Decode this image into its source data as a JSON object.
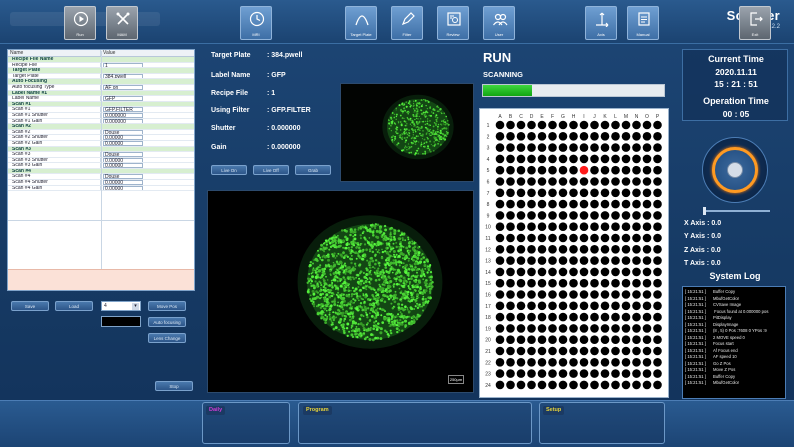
{
  "app": {
    "title": "Scanner",
    "version": "Version 1.4.2.2"
  },
  "properties": {
    "col_name": "Name",
    "col_value": "Value",
    "rows": [
      {
        "type": "section",
        "name": "Recipe File Name"
      },
      {
        "type": "field",
        "name": "Recipe File",
        "value": "1"
      },
      {
        "type": "section",
        "name": "Target Plate"
      },
      {
        "type": "field",
        "name": "Target Plate",
        "value": "384.pwell"
      },
      {
        "type": "section",
        "name": "Auto Focusing"
      },
      {
        "type": "field",
        "name": "Auto focusing Type",
        "value": "AF on"
      },
      {
        "type": "section",
        "name": "Label Name #1"
      },
      {
        "type": "field",
        "name": "Label Name",
        "value": "GFP"
      },
      {
        "type": "section",
        "name": "Scan #1"
      },
      {
        "type": "field",
        "name": "Scan #1",
        "value": "GFP.FILTER"
      },
      {
        "type": "field",
        "name": "Scan #1 Shutter",
        "value": "0.000000"
      },
      {
        "type": "field",
        "name": "Scan #1 Gain",
        "value": "0.000000"
      },
      {
        "type": "section",
        "name": "Scan #2"
      },
      {
        "type": "field",
        "name": "Scan #2",
        "value": "Douse"
      },
      {
        "type": "field",
        "name": "Scan #2 Shutter",
        "value": "0.00000"
      },
      {
        "type": "field",
        "name": "Scan #2 Gain",
        "value": "0.00000"
      },
      {
        "type": "section",
        "name": "Scan #3"
      },
      {
        "type": "field",
        "name": "Scan #3",
        "value": "Douse"
      },
      {
        "type": "field",
        "name": "Scan #3 Shutter",
        "value": "0.00000"
      },
      {
        "type": "field",
        "name": "Scan #3 Gain",
        "value": "0.00000"
      },
      {
        "type": "section",
        "name": "Scan #4"
      },
      {
        "type": "field",
        "name": "Scan #4",
        "value": "Douse"
      },
      {
        "type": "field",
        "name": "Scan #4 Shutter",
        "value": "0.00000"
      },
      {
        "type": "field",
        "name": "Scan #4 Gain",
        "value": "0.00000"
      }
    ]
  },
  "left_controls": {
    "save": "Save",
    "load": "Load",
    "dropdown_value": "4",
    "move_pos": "Move Pos",
    "auto_focusing": "Auto focusing",
    "lens_change": "Lens Change",
    "stop": "Stop"
  },
  "info": {
    "target_plate_label": "Target Plate",
    "target_plate_value": ": 384.pwell",
    "label_name_label": "Label Name",
    "label_name_value": ": GFP",
    "recipe_file_label": "Recipe File",
    "recipe_file_value": ": 1",
    "using_filter_label": "Using Filter",
    "using_filter_value": ": GFP.FILTER",
    "shutter_label": "Shutter",
    "shutter_value": ": 0.000000",
    "gain_label": "Gain",
    "gain_value": ": 0.000000",
    "live_on": "Live On",
    "live_off": "Live Off",
    "grab": "Grab"
  },
  "scale_bar": "250µm",
  "run": {
    "title": "RUN",
    "status": "SCANNING",
    "progress": 0.27,
    "plate_columns": [
      "A",
      "B",
      "C",
      "D",
      "E",
      "F",
      "G",
      "H",
      "I",
      "J",
      "K",
      "L",
      "M",
      "N",
      "O",
      "P"
    ],
    "plate_rows": 24,
    "active_well": {
      "col": 8,
      "row": 4
    },
    "colors": {
      "well": "#000000",
      "active": "#ff1a1a",
      "progress": "#22bb22"
    }
  },
  "right": {
    "current_time_label": "Current Time",
    "date": "2020.11.11",
    "time": "15 : 21 : 51",
    "operation_time_label": "Operation Time",
    "operation_time": "00 : 05",
    "x_axis": "X Axis :  0.0",
    "y_axis": "Y Axis :  0.0",
    "z_axis": "Z Axis :  0.0",
    "t_axis": "T Axis :  0.0",
    "system_log_label": "System Log",
    "log": [
      {
        "ts": "[ 15:21:51 ]",
        "msg": "Buffer Copy"
      },
      {
        "ts": "[ 15:21:51 ]",
        "msg": "MbufGetColor"
      },
      {
        "ts": "[ 15:21:51 ]",
        "msg": "CVSave Image"
      },
      {
        "ts": "[ 15:21:51 ]",
        "msg": " Focus found at 0.000000 pos"
      },
      {
        "ts": "[ 15:21:51 ]",
        "msg": "PitDisplay"
      },
      {
        "ts": "[ 15:21:51 ]",
        "msg": "DisplayImage"
      },
      {
        "ts": "[ 15:21:51 ]",
        "msg": "(8 , 5) 0 Pos :7608 0 YPos :9"
      },
      {
        "ts": "[ 15:21:51 ]",
        "msg": "2 MOVE speed 0"
      },
      {
        "ts": "[ 15:21:51 ]",
        "msg": "Focus start"
      },
      {
        "ts": "[ 15:21:51 ]",
        "msg": "Af Focus end"
      },
      {
        "ts": "[ 15:21:51 ]",
        "msg": "AF speed 10"
      },
      {
        "ts": "[ 15:21:51 ]",
        "msg": "Go Z Pos"
      },
      {
        "ts": "[ 15:21:51 ]",
        "msg": "Move Z Pos"
      },
      {
        "ts": "[ 15:21:51 ]",
        "msg": "Buffer Copy"
      },
      {
        "ts": "[ 15:21:51 ]",
        "msg": "MbufGetColor"
      }
    ]
  },
  "toolbar": {
    "run": "Run",
    "mam": "MAM",
    "daily_tag": "Daily",
    "mri": "MRI",
    "program_tag": "Program",
    "target_plate": "Target  Plate",
    "filter": "Filter",
    "review": "Review",
    "user": "User",
    "setup_tag": "Setup",
    "axis": "Axis",
    "manual": "Manual",
    "exit": "Exit"
  }
}
